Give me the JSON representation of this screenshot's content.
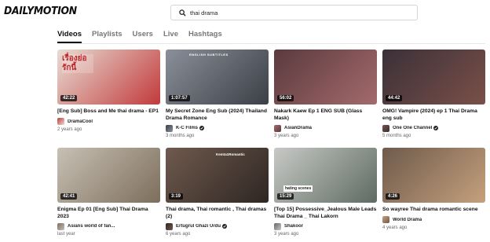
{
  "header": {
    "logo": "DAILYMOTION",
    "search": {
      "value": "thai drama",
      "placeholder": ""
    }
  },
  "tabs": [
    {
      "label": "Videos",
      "active": true
    },
    {
      "label": "Playlists",
      "active": false
    },
    {
      "label": "Users",
      "active": false
    },
    {
      "label": "Live",
      "active": false
    },
    {
      "label": "Hashtags",
      "active": false
    }
  ],
  "videos": [
    {
      "title": "[Eng Sub] Boss and Me thai drama - EP1",
      "duration": "42:22",
      "channel": "DramaCool",
      "verified": false,
      "age": "2 years ago",
      "thumb_text": "เรื่องย่อ รักนี้",
      "thumb_colors": [
        "#e8dcd4",
        "#c23a3a"
      ]
    },
    {
      "title": "My Secret Zone Eng Sub (2024) Thailand Drama Romance",
      "duration": "1:07:57",
      "channel": "K-C Films",
      "verified": true,
      "age": "3 months ago",
      "thumb_text": "ENGLISH SUBTITLES",
      "thumb_colors": [
        "#8a8f99",
        "#3b3f46"
      ]
    },
    {
      "title": "Nakark Kaew Ep 1 ENG SUB (Glass Mask)",
      "duration": "56:02",
      "channel": "AsianDrama",
      "verified": false,
      "age": "3 years ago",
      "thumb_text": "",
      "thumb_colors": [
        "#5a3a3e",
        "#a46a6c"
      ]
    },
    {
      "title": "OMG! Vampire (2024) ep 1 Thai Drama eng sub",
      "duration": "44:42",
      "channel": "One One Channel",
      "verified": true,
      "age": "5 months ago",
      "thumb_text": "",
      "thumb_colors": [
        "#3a3038",
        "#7a5048"
      ]
    },
    {
      "title": "Enigma Ep 01 [Eng Sub] Thai Drama 2023",
      "duration": "42:41",
      "channel": "Asians world of fan...",
      "verified": false,
      "age": "last year",
      "thumb_text": "",
      "thumb_colors": [
        "#c7c0b4",
        "#7d6e5c"
      ]
    },
    {
      "title": "Thai drama, Thai romantic , Thai dramas (2)",
      "duration": "3:19",
      "channel": "Ertugrul Ghazi Urdu",
      "verified": true,
      "age": "6 years ago",
      "thumb_text": "Kemta1Romantic",
      "thumb_colors": [
        "#6f5a4e",
        "#2e2622"
      ]
    },
    {
      "title": "[Top 15] Possessive_Jealous Male Leads Thai Drama _ Thai Lakorn",
      "duration": "15:29",
      "channel": "Shakoor",
      "verified": false,
      "age": "3 years ago",
      "thumb_text": "hating scenes",
      "thumb_colors": [
        "#c8c9c6",
        "#5e6b62"
      ]
    },
    {
      "title": "So wayree Thai drama romantic scene",
      "duration": "4:26",
      "channel": "World Drama",
      "verified": false,
      "age": "4 years ago",
      "thumb_text": "",
      "thumb_colors": [
        "#6e5a4c",
        "#c5a07c"
      ]
    }
  ],
  "colors": {
    "accent": "#0d0d0d",
    "muted": "#777777",
    "verified_badge": "#222222"
  },
  "icons": {
    "search": "search-icon",
    "verified": "verified-check-icon"
  }
}
